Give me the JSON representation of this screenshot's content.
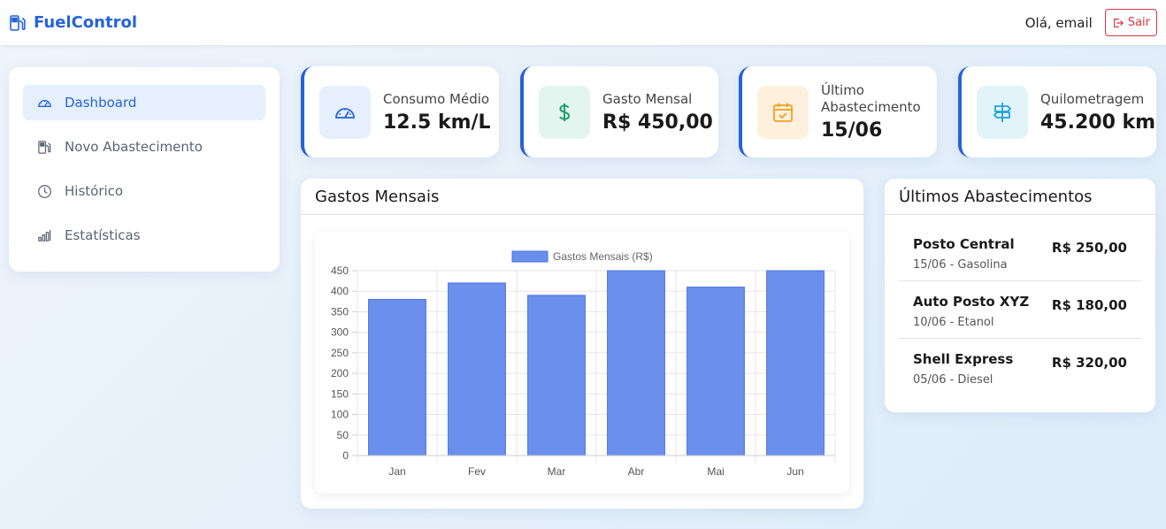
{
  "brand": {
    "name": "FuelControl",
    "icon": "fuel-pump-icon",
    "color": "#2563d9"
  },
  "header": {
    "greeting": "Olá, email",
    "logout_label": "Sair"
  },
  "sidebar": {
    "items": [
      {
        "label": "Dashboard",
        "icon": "speedometer-icon",
        "active": true
      },
      {
        "label": "Novo Abastecimento",
        "icon": "fuel-pump-icon",
        "active": false
      },
      {
        "label": "Histórico",
        "icon": "clock-icon",
        "active": false
      },
      {
        "label": "Estatísticas",
        "icon": "bar-chart-icon",
        "active": false
      }
    ]
  },
  "cards": [
    {
      "label": "Consumo Médio",
      "value": "12.5 km/L",
      "icon": "speedometer-icon",
      "icon_bg": "#e6effc",
      "icon_color": "#2563d9"
    },
    {
      "label": "Gasto Mensal",
      "value": "R$ 450,00",
      "icon": "dollar-icon",
      "icon_bg": "#e3f5ee",
      "icon_color": "#1f9d6b"
    },
    {
      "label": "Último Abastecimento",
      "value": "15/06",
      "icon": "calendar-check-icon",
      "icon_bg": "#fdf0dc",
      "icon_color": "#f0a020"
    },
    {
      "label": "Quilometragem",
      "value": "45.200 km",
      "icon": "signpost-icon",
      "icon_bg": "#e2f3fa",
      "icon_color": "#1aa5d8"
    }
  ],
  "chart_panel": {
    "title": "Gastos Mensais"
  },
  "chart_data": {
    "type": "bar",
    "categories": [
      "Jan",
      "Fev",
      "Mar",
      "Abr",
      "Mai",
      "Jun"
    ],
    "series": [
      {
        "name": "Gastos Mensais (R$)",
        "values": [
          380,
          420,
          390,
          450,
          410,
          450
        ]
      }
    ],
    "ylim": [
      0,
      450
    ],
    "yticks": [
      0,
      50,
      100,
      150,
      200,
      250,
      300,
      350,
      400,
      450
    ],
    "grid": true,
    "legend": "top",
    "bar_color": "#6b8fec",
    "bar_border": "#4a72e0"
  },
  "recent_panel": {
    "title": "Últimos Abastecimentos",
    "items": [
      {
        "station": "Posto Central",
        "detail": "15/06 - Gasolina",
        "amount": "R$ 250,00"
      },
      {
        "station": "Auto Posto XYZ",
        "detail": "10/06 - Etanol",
        "amount": "R$ 180,00"
      },
      {
        "station": "Shell Express",
        "detail": "05/06 - Diesel",
        "amount": "R$ 320,00"
      }
    ]
  }
}
